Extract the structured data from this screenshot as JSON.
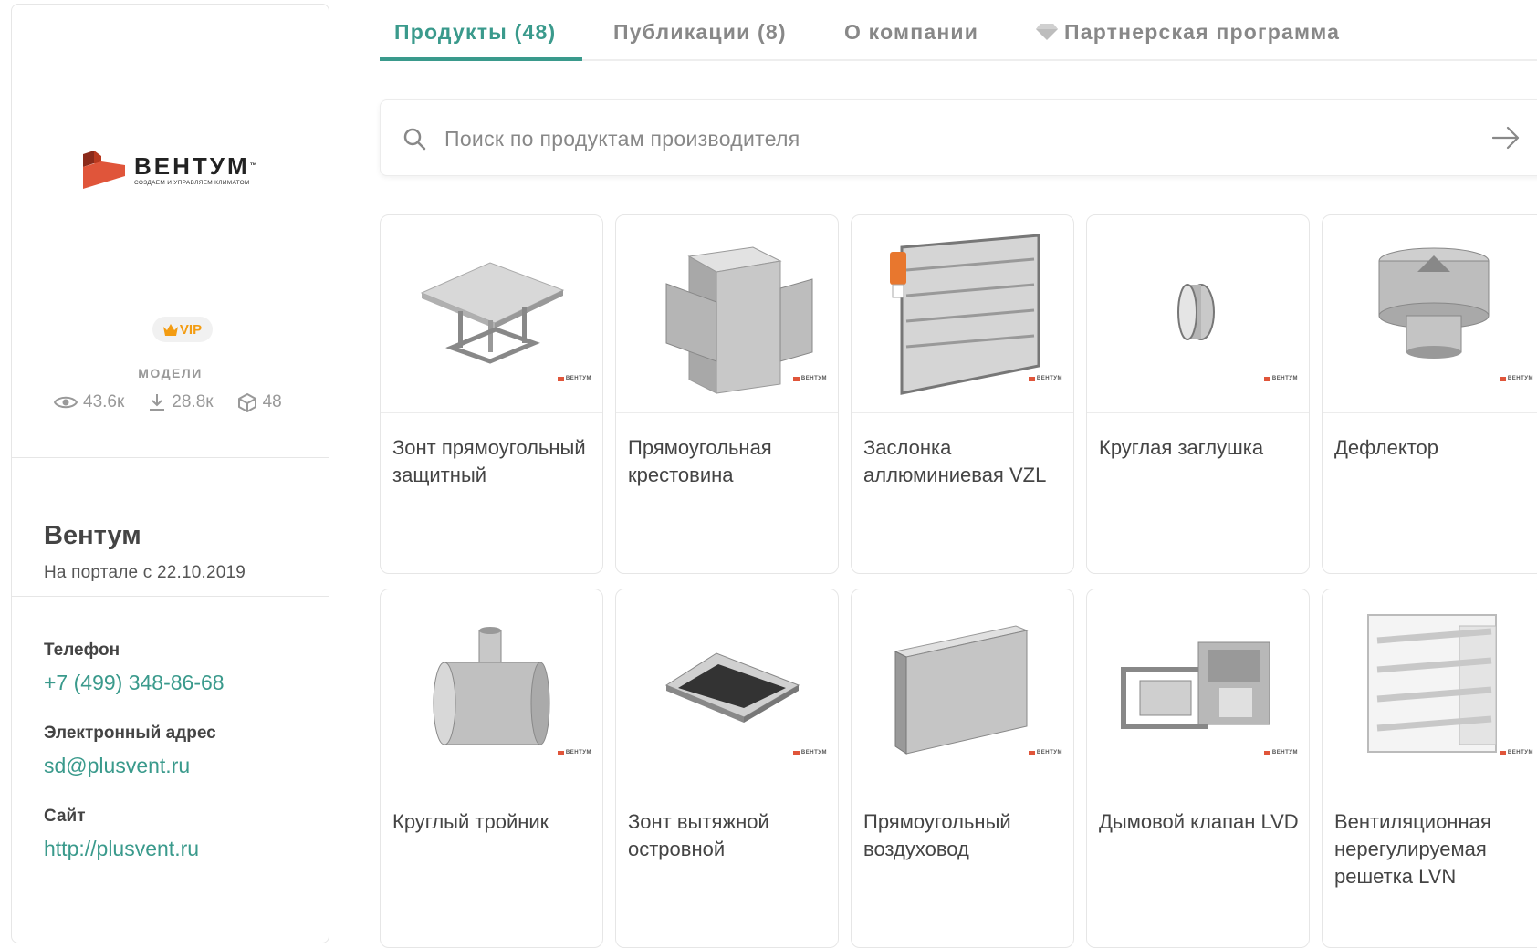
{
  "sidebar": {
    "logo": {
      "name": "ВЕНТУМ",
      "tm": "™",
      "tagline": "СОЗДАЕМ И УПРАВЛЯЕМ КЛИМАТОМ"
    },
    "vip_label": "VIP",
    "models_label": "МОДЕЛИ",
    "stats": {
      "views": "43.6к",
      "downloads": "28.8к",
      "models": "48"
    },
    "company_name": "Вентум",
    "since": "На портале с 22.10.2019",
    "contacts": {
      "phone_label": "Телефон",
      "phone": "+7 (499) 348-86-68",
      "email_label": "Электронный адрес",
      "email": "sd@plusvent.ru",
      "site_label": "Сайт",
      "site": "http://plusvent.ru"
    }
  },
  "tabs": [
    {
      "label": "Продукты (48)",
      "active": true
    },
    {
      "label": "Публикации (8)",
      "active": false
    },
    {
      "label": "О компании",
      "active": false
    },
    {
      "label": "Партнерская программа",
      "active": false,
      "icon": "diamond-icon"
    }
  ],
  "search": {
    "placeholder": "Поиск по продуктам производителя",
    "value": ""
  },
  "products": [
    {
      "title": "Зонт прямоугольный защитный",
      "icon": "canopy"
    },
    {
      "title": "Прямоугольная крестовина",
      "icon": "cross-duct"
    },
    {
      "title": "Заслонка аллюминиевая VZL",
      "icon": "damper"
    },
    {
      "title": "Круглая заглушка",
      "icon": "round-cap"
    },
    {
      "title": "Дефлектор",
      "icon": "deflector"
    },
    {
      "title": "Круглый тройник",
      "icon": "round-tee"
    },
    {
      "title": "Зонт вытяжной островной",
      "icon": "island-hood"
    },
    {
      "title": "Прямоугольный воздуховод",
      "icon": "rect-duct"
    },
    {
      "title": "Дымовой клапан LVD",
      "icon": "smoke-valve"
    },
    {
      "title": "Вентиляционная нерегулируемая решетка LVN",
      "icon": "louver-grille"
    }
  ],
  "brand_mark": "ВЕНТУМ",
  "colors": {
    "accent": "#3a9a8c",
    "vip": "#f39c12",
    "logo_red": "#e0553a"
  }
}
